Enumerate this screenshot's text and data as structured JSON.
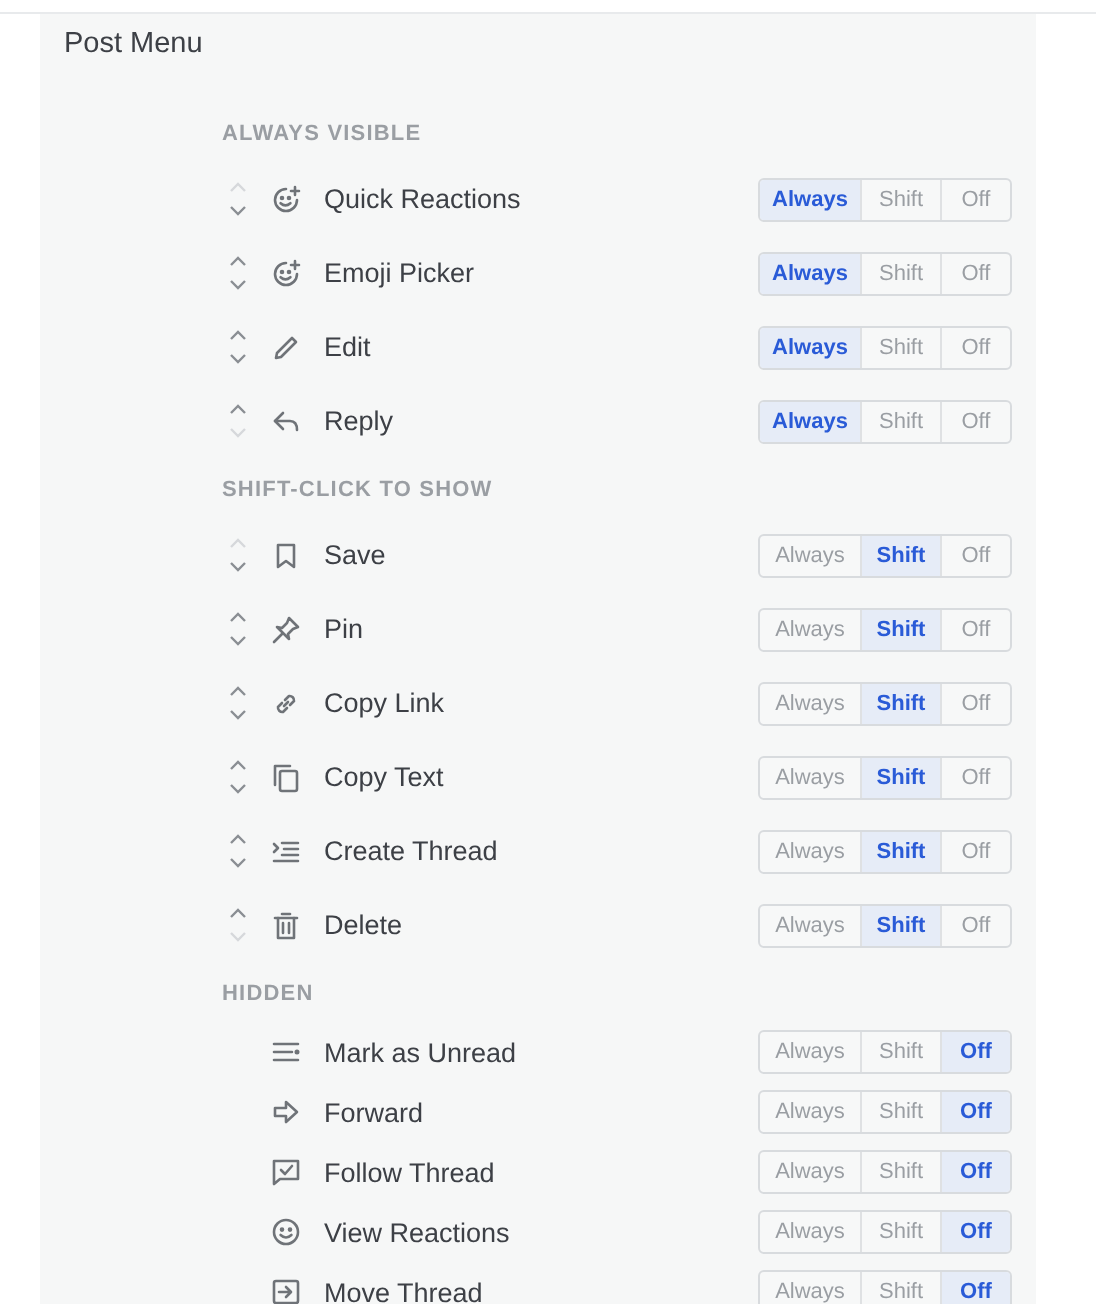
{
  "title": "Post Menu",
  "sections": [
    {
      "heading": "ALWAYS VISIBLE",
      "reorderable": true,
      "items": [
        {
          "label": "Quick Reactions",
          "up_disabled": true,
          "down_disabled": false,
          "options": [
            {
              "label": "Always",
              "selected": true
            },
            {
              "label": "Shift",
              "selected": false
            },
            {
              "label": "Off",
              "selected": false
            }
          ]
        },
        {
          "label": "Emoji Picker",
          "up_disabled": false,
          "down_disabled": false,
          "options": [
            {
              "label": "Always",
              "selected": true
            },
            {
              "label": "Shift",
              "selected": false
            },
            {
              "label": "Off",
              "selected": false
            }
          ]
        },
        {
          "label": "Edit",
          "up_disabled": false,
          "down_disabled": false,
          "options": [
            {
              "label": "Always",
              "selected": true
            },
            {
              "label": "Shift",
              "selected": false
            },
            {
              "label": "Off",
              "selected": false
            }
          ]
        },
        {
          "label": "Reply",
          "up_disabled": false,
          "down_disabled": true,
          "options": [
            {
              "label": "Always",
              "selected": true
            },
            {
              "label": "Shift",
              "selected": false
            },
            {
              "label": "Off",
              "selected": false
            }
          ]
        }
      ]
    },
    {
      "heading": "SHIFT-CLICK TO SHOW",
      "reorderable": true,
      "items": [
        {
          "label": "Save",
          "up_disabled": true,
          "down_disabled": false,
          "options": [
            {
              "label": "Always",
              "selected": false
            },
            {
              "label": "Shift",
              "selected": true
            },
            {
              "label": "Off",
              "selected": false
            }
          ]
        },
        {
          "label": "Pin",
          "up_disabled": false,
          "down_disabled": false,
          "options": [
            {
              "label": "Always",
              "selected": false
            },
            {
              "label": "Shift",
              "selected": true
            },
            {
              "label": "Off",
              "selected": false
            }
          ]
        },
        {
          "label": "Copy Link",
          "up_disabled": false,
          "down_disabled": false,
          "options": [
            {
              "label": "Always",
              "selected": false
            },
            {
              "label": "Shift",
              "selected": true
            },
            {
              "label": "Off",
              "selected": false
            }
          ]
        },
        {
          "label": "Copy Text",
          "up_disabled": false,
          "down_disabled": false,
          "options": [
            {
              "label": "Always",
              "selected": false
            },
            {
              "label": "Shift",
              "selected": true
            },
            {
              "label": "Off",
              "selected": false
            }
          ]
        },
        {
          "label": "Create Thread",
          "up_disabled": false,
          "down_disabled": false,
          "options": [
            {
              "label": "Always",
              "selected": false
            },
            {
              "label": "Shift",
              "selected": true
            },
            {
              "label": "Off",
              "selected": false
            }
          ]
        },
        {
          "label": "Delete",
          "up_disabled": false,
          "down_disabled": true,
          "options": [
            {
              "label": "Always",
              "selected": false
            },
            {
              "label": "Shift",
              "selected": true
            },
            {
              "label": "Off",
              "selected": false
            }
          ]
        }
      ]
    },
    {
      "heading": "HIDDEN",
      "reorderable": false,
      "items": [
        {
          "label": "Mark as Unread",
          "options": [
            {
              "label": "Always",
              "selected": false
            },
            {
              "label": "Shift",
              "selected": false
            },
            {
              "label": "Off",
              "selected": true
            }
          ]
        },
        {
          "label": "Forward",
          "options": [
            {
              "label": "Always",
              "selected": false
            },
            {
              "label": "Shift",
              "selected": false
            },
            {
              "label": "Off",
              "selected": true
            }
          ]
        },
        {
          "label": "Follow Thread",
          "options": [
            {
              "label": "Always",
              "selected": false
            },
            {
              "label": "Shift",
              "selected": false
            },
            {
              "label": "Off",
              "selected": true
            }
          ]
        },
        {
          "label": "View Reactions",
          "options": [
            {
              "label": "Always",
              "selected": false
            },
            {
              "label": "Shift",
              "selected": false
            },
            {
              "label": "Off",
              "selected": true
            }
          ]
        },
        {
          "label": "Move Thread",
          "options": [
            {
              "label": "Always",
              "selected": false
            },
            {
              "label": "Shift",
              "selected": false
            },
            {
              "label": "Off",
              "selected": true
            }
          ]
        }
      ]
    }
  ]
}
